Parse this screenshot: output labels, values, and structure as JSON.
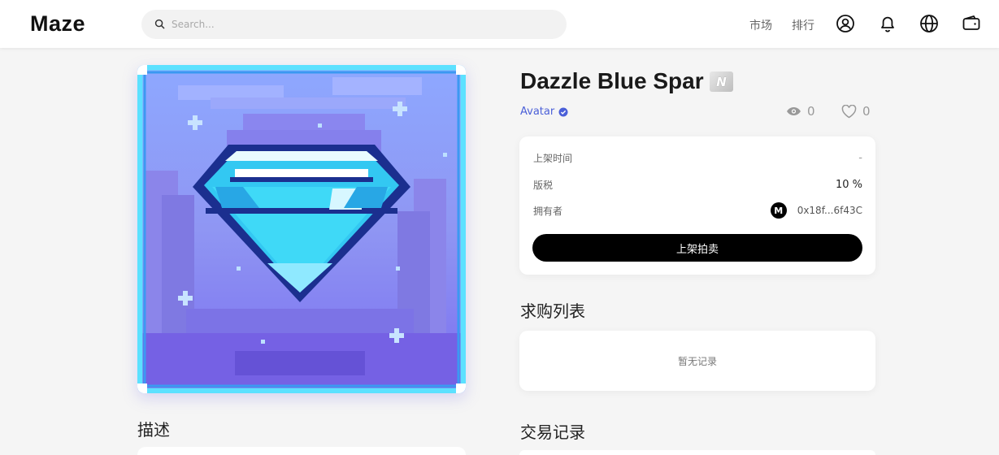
{
  "header": {
    "logo": "Maze",
    "search_placeholder": "Search...",
    "nav": {
      "market": "市场",
      "ranking": "排行"
    },
    "icons": [
      "user-icon",
      "bell-icon",
      "globe-icon",
      "wallet-icon"
    ]
  },
  "nft": {
    "title": "Dazzle Blue Spar",
    "rarity": "N",
    "collection": "Avatar",
    "views": "0",
    "likes": "0"
  },
  "info": {
    "listed_time_label": "上架时间",
    "listed_time_value": "-",
    "royalty_label": "版税",
    "royalty_value": "10 %",
    "owner_label": "拥有者",
    "owner_avatar": "M",
    "owner_address": "0x18f...6f43C",
    "list_button": "上架拍卖"
  },
  "sections": {
    "description": "描述",
    "bids": "求购列表",
    "bids_empty": "暂无记录",
    "trades": "交易记录"
  },
  "colors": {
    "accent": "#4a5fd8",
    "button": "#000000",
    "background": "#f5f5f5"
  }
}
